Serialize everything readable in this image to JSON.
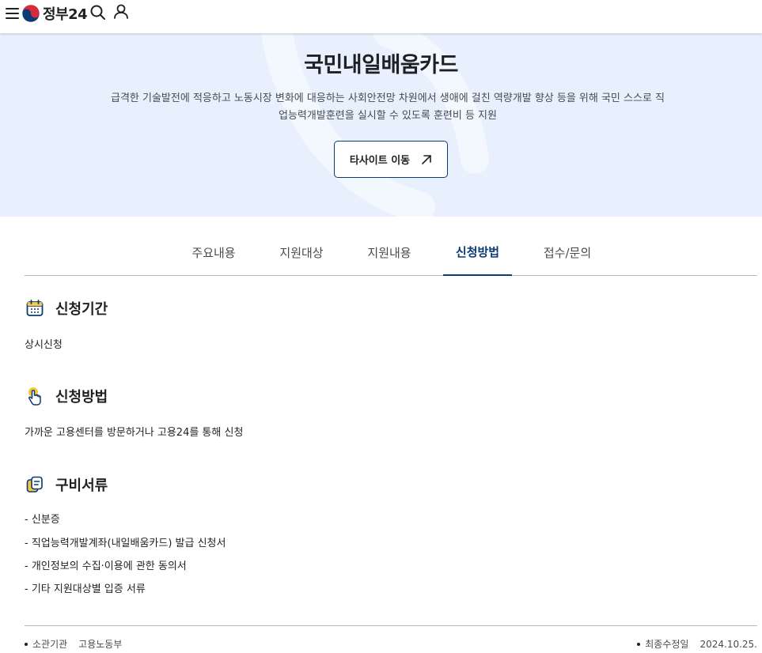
{
  "header": {
    "logo_text": "정부24",
    "menu_icon": "hamburger-menu-icon",
    "search_icon": "search-icon",
    "user_icon": "user-icon"
  },
  "hero": {
    "title": "국민내일배움카드",
    "description": "급격한 기술발전에 적응하고 노동시장 변화에 대응하는 사회안전망 차원에서 생애에 걸친 역량개발 향상 등을 위해 국민 스스로 직업능력개발훈련을 실시할 수 있도록 훈련비 등 지원",
    "button_label": "타사이트 이동",
    "button_icon": "arrow-up-right-icon"
  },
  "tabs": [
    {
      "label": "주요내용",
      "active": false
    },
    {
      "label": "지원대상",
      "active": false
    },
    {
      "label": "지원내용",
      "active": false
    },
    {
      "label": "신청방법",
      "active": true
    },
    {
      "label": "접수/문의",
      "active": false
    }
  ],
  "sections": {
    "period": {
      "heading": "신청기간",
      "icon": "calendar-icon",
      "text": "상시신청"
    },
    "method": {
      "heading": "신청방법",
      "icon": "hand-pointer-icon",
      "text": "가까운 고용센터를 방문하거나 고용24를 통해 신청"
    },
    "documents": {
      "heading": "구비서류",
      "icon": "document-copy-icon",
      "items": [
        "- 신분증",
        "- 직업능력개발계좌(내일배움카드) 발급 신청서",
        "- 개인정보의 수집·이용에 관한 동의서",
        "- 기타 지원대상별 입증 서류"
      ]
    }
  },
  "footer": {
    "agency_label": "소관기관",
    "agency_value": "고용노동부",
    "updated_label": "최종수정일",
    "updated_value": "2024.10.25."
  },
  "colors": {
    "accent": "#0b3a75",
    "hero_bg": "#e8f0fd",
    "icon_yellow": "#f5c63c"
  }
}
